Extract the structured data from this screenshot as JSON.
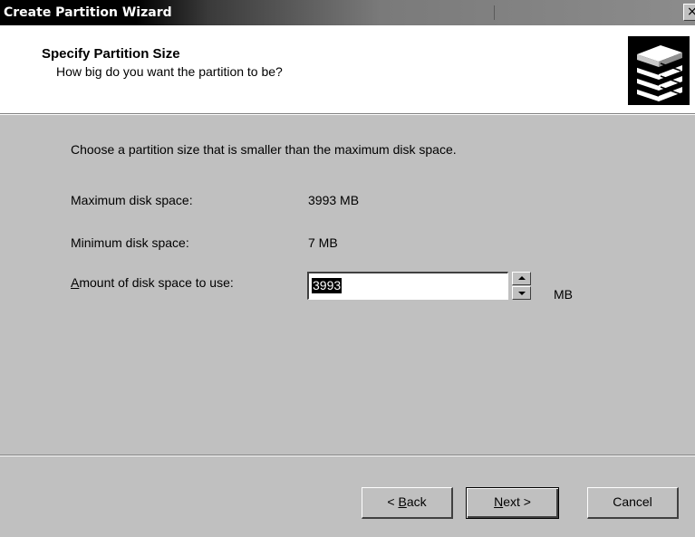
{
  "window": {
    "title": "Create Partition Wizard",
    "close_glyph": "×"
  },
  "header": {
    "title": "Specify Partition Size",
    "subtitle": "How big do you want the partition to be?",
    "icon": "disk-stack-icon"
  },
  "body": {
    "instruction": "Choose a partition size that is smaller than the maximum disk space.",
    "max_label": "Maximum disk space:",
    "max_value": "3993 MB",
    "min_label": "Minimum disk space:",
    "min_value": "7 MB",
    "amount_label_accel": "A",
    "amount_label_rest": "mount of disk space to use:",
    "amount_value": "3993",
    "amount_unit": "MB"
  },
  "buttons": {
    "back_prefix": "< ",
    "back_accel": "B",
    "back_rest": "ack",
    "next_accel": "N",
    "next_rest": "ext >",
    "cancel": "Cancel"
  }
}
